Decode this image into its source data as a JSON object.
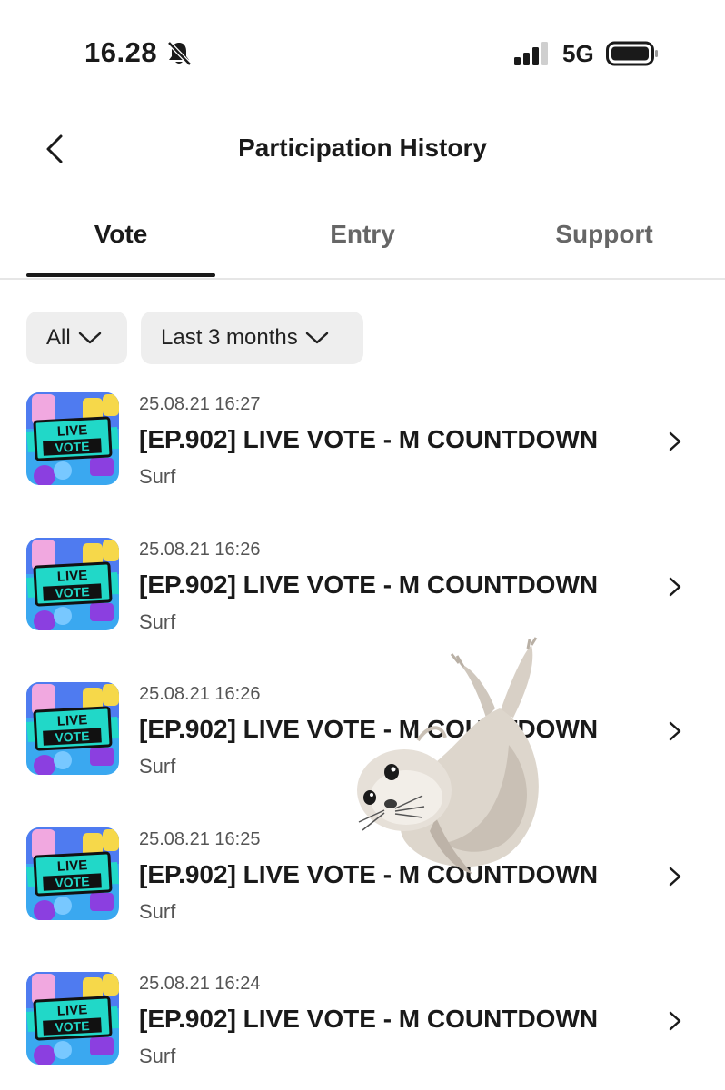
{
  "status_bar": {
    "time": "16.28",
    "network": "5G",
    "icons": [
      "bell-slash-icon",
      "signal-icon",
      "battery-icon"
    ]
  },
  "header": {
    "title": "Participation History",
    "back_icon": "chevron-left-icon"
  },
  "tabs": [
    {
      "label": "Vote",
      "active": true
    },
    {
      "label": "Entry",
      "active": false
    },
    {
      "label": "Support",
      "active": false
    }
  ],
  "filters": {
    "type": "All",
    "period": "Last 3 months"
  },
  "items": [
    {
      "time": "25.08.21 16:27",
      "title": "[EP.902] LIVE VOTE - M COUNTDOWN",
      "subtitle": "Surf"
    },
    {
      "time": "25.08.21 16:26",
      "title": "[EP.902] LIVE VOTE - M COUNTDOWN",
      "subtitle": "Surf"
    },
    {
      "time": "25.08.21 16:26",
      "title": "[EP.902] LIVE VOTE - M COUNTDOWN",
      "subtitle": "Surf"
    },
    {
      "time": "25.08.21 16:25",
      "title": "[EP.902] LIVE VOTE - M COUNTDOWN",
      "subtitle": "Surf"
    },
    {
      "time": "25.08.21 16:24",
      "title": "[EP.902] LIVE VOTE - M COUNTDOWN",
      "subtitle": "Surf"
    }
  ],
  "thumbnail": {
    "line1": "LIVE",
    "line2": "VOTE"
  },
  "colors": {
    "text_primary": "#1a1a1a",
    "text_secondary": "#555555",
    "chip_bg": "#eeeeee",
    "thumb_bg": "#3aa8f0",
    "thumb_band": "#21d8c8"
  }
}
